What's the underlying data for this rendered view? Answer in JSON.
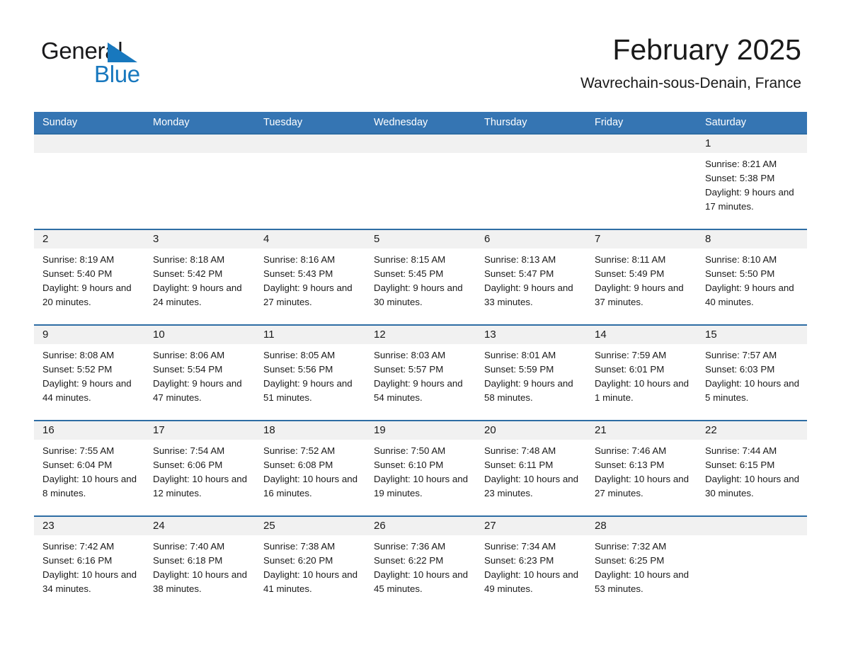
{
  "brand": {
    "name_part1": "General",
    "name_part2": "Blue",
    "triangle_color": "#1878be"
  },
  "header": {
    "title": "February 2025",
    "subtitle": "Wavrechain-sous-Denain, France",
    "header_bg_color": "#3575b3",
    "row_divider_color": "#2e6da4",
    "daynum_bg_color": "#f1f1f1"
  },
  "weekdays": [
    "Sunday",
    "Monday",
    "Tuesday",
    "Wednesday",
    "Thursday",
    "Friday",
    "Saturday"
  ],
  "weeks": [
    [
      {
        "day": "",
        "sunrise": "",
        "sunset": "",
        "daylight": ""
      },
      {
        "day": "",
        "sunrise": "",
        "sunset": "",
        "daylight": ""
      },
      {
        "day": "",
        "sunrise": "",
        "sunset": "",
        "daylight": ""
      },
      {
        "day": "",
        "sunrise": "",
        "sunset": "",
        "daylight": ""
      },
      {
        "day": "",
        "sunrise": "",
        "sunset": "",
        "daylight": ""
      },
      {
        "day": "",
        "sunrise": "",
        "sunset": "",
        "daylight": ""
      },
      {
        "day": "1",
        "sunrise": "Sunrise: 8:21 AM",
        "sunset": "Sunset: 5:38 PM",
        "daylight": "Daylight: 9 hours and 17 minutes."
      }
    ],
    [
      {
        "day": "2",
        "sunrise": "Sunrise: 8:19 AM",
        "sunset": "Sunset: 5:40 PM",
        "daylight": "Daylight: 9 hours and 20 minutes."
      },
      {
        "day": "3",
        "sunrise": "Sunrise: 8:18 AM",
        "sunset": "Sunset: 5:42 PM",
        "daylight": "Daylight: 9 hours and 24 minutes."
      },
      {
        "day": "4",
        "sunrise": "Sunrise: 8:16 AM",
        "sunset": "Sunset: 5:43 PM",
        "daylight": "Daylight: 9 hours and 27 minutes."
      },
      {
        "day": "5",
        "sunrise": "Sunrise: 8:15 AM",
        "sunset": "Sunset: 5:45 PM",
        "daylight": "Daylight: 9 hours and 30 minutes."
      },
      {
        "day": "6",
        "sunrise": "Sunrise: 8:13 AM",
        "sunset": "Sunset: 5:47 PM",
        "daylight": "Daylight: 9 hours and 33 minutes."
      },
      {
        "day": "7",
        "sunrise": "Sunrise: 8:11 AM",
        "sunset": "Sunset: 5:49 PM",
        "daylight": "Daylight: 9 hours and 37 minutes."
      },
      {
        "day": "8",
        "sunrise": "Sunrise: 8:10 AM",
        "sunset": "Sunset: 5:50 PM",
        "daylight": "Daylight: 9 hours and 40 minutes."
      }
    ],
    [
      {
        "day": "9",
        "sunrise": "Sunrise: 8:08 AM",
        "sunset": "Sunset: 5:52 PM",
        "daylight": "Daylight: 9 hours and 44 minutes."
      },
      {
        "day": "10",
        "sunrise": "Sunrise: 8:06 AM",
        "sunset": "Sunset: 5:54 PM",
        "daylight": "Daylight: 9 hours and 47 minutes."
      },
      {
        "day": "11",
        "sunrise": "Sunrise: 8:05 AM",
        "sunset": "Sunset: 5:56 PM",
        "daylight": "Daylight: 9 hours and 51 minutes."
      },
      {
        "day": "12",
        "sunrise": "Sunrise: 8:03 AM",
        "sunset": "Sunset: 5:57 PM",
        "daylight": "Daylight: 9 hours and 54 minutes."
      },
      {
        "day": "13",
        "sunrise": "Sunrise: 8:01 AM",
        "sunset": "Sunset: 5:59 PM",
        "daylight": "Daylight: 9 hours and 58 minutes."
      },
      {
        "day": "14",
        "sunrise": "Sunrise: 7:59 AM",
        "sunset": "Sunset: 6:01 PM",
        "daylight": "Daylight: 10 hours and 1 minute."
      },
      {
        "day": "15",
        "sunrise": "Sunrise: 7:57 AM",
        "sunset": "Sunset: 6:03 PM",
        "daylight": "Daylight: 10 hours and 5 minutes."
      }
    ],
    [
      {
        "day": "16",
        "sunrise": "Sunrise: 7:55 AM",
        "sunset": "Sunset: 6:04 PM",
        "daylight": "Daylight: 10 hours and 8 minutes."
      },
      {
        "day": "17",
        "sunrise": "Sunrise: 7:54 AM",
        "sunset": "Sunset: 6:06 PM",
        "daylight": "Daylight: 10 hours and 12 minutes."
      },
      {
        "day": "18",
        "sunrise": "Sunrise: 7:52 AM",
        "sunset": "Sunset: 6:08 PM",
        "daylight": "Daylight: 10 hours and 16 minutes."
      },
      {
        "day": "19",
        "sunrise": "Sunrise: 7:50 AM",
        "sunset": "Sunset: 6:10 PM",
        "daylight": "Daylight: 10 hours and 19 minutes."
      },
      {
        "day": "20",
        "sunrise": "Sunrise: 7:48 AM",
        "sunset": "Sunset: 6:11 PM",
        "daylight": "Daylight: 10 hours and 23 minutes."
      },
      {
        "day": "21",
        "sunrise": "Sunrise: 7:46 AM",
        "sunset": "Sunset: 6:13 PM",
        "daylight": "Daylight: 10 hours and 27 minutes."
      },
      {
        "day": "22",
        "sunrise": "Sunrise: 7:44 AM",
        "sunset": "Sunset: 6:15 PM",
        "daylight": "Daylight: 10 hours and 30 minutes."
      }
    ],
    [
      {
        "day": "23",
        "sunrise": "Sunrise: 7:42 AM",
        "sunset": "Sunset: 6:16 PM",
        "daylight": "Daylight: 10 hours and 34 minutes."
      },
      {
        "day": "24",
        "sunrise": "Sunrise: 7:40 AM",
        "sunset": "Sunset: 6:18 PM",
        "daylight": "Daylight: 10 hours and 38 minutes."
      },
      {
        "day": "25",
        "sunrise": "Sunrise: 7:38 AM",
        "sunset": "Sunset: 6:20 PM",
        "daylight": "Daylight: 10 hours and 41 minutes."
      },
      {
        "day": "26",
        "sunrise": "Sunrise: 7:36 AM",
        "sunset": "Sunset: 6:22 PM",
        "daylight": "Daylight: 10 hours and 45 minutes."
      },
      {
        "day": "27",
        "sunrise": "Sunrise: 7:34 AM",
        "sunset": "Sunset: 6:23 PM",
        "daylight": "Daylight: 10 hours and 49 minutes."
      },
      {
        "day": "28",
        "sunrise": "Sunrise: 7:32 AM",
        "sunset": "Sunset: 6:25 PM",
        "daylight": "Daylight: 10 hours and 53 minutes."
      },
      {
        "day": "",
        "sunrise": "",
        "sunset": "",
        "daylight": ""
      }
    ]
  ]
}
